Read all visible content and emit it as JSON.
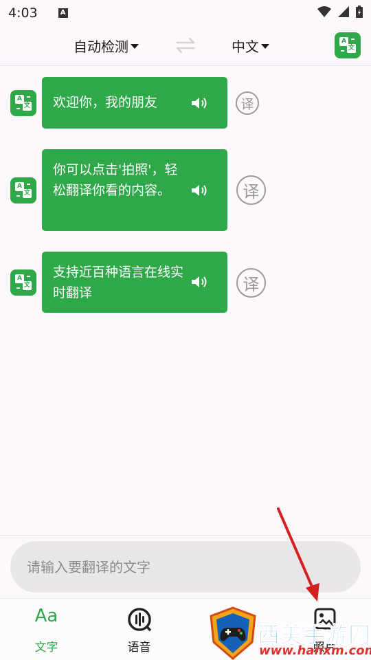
{
  "status_bar": {
    "time": "4:03",
    "a_icon": "A"
  },
  "header": {
    "source_language": "自动检测",
    "target_language": "中文"
  },
  "messages": [
    {
      "text": "欢迎你，我的朋友",
      "translate_label": "译"
    },
    {
      "text": "你可以点击'拍照'，轻松翻译你看的内容。",
      "translate_label": "译"
    },
    {
      "text": "支持近百种语言在线实时翻译",
      "translate_label": "译"
    }
  ],
  "input": {
    "placeholder": "请输入要翻译的文字"
  },
  "nav": [
    {
      "label": "文字",
      "icon": "Aa"
    },
    {
      "label": "语音",
      "icon": "voice-icon"
    },
    {
      "label": "",
      "icon": "camera-icon"
    },
    {
      "label": "照片",
      "icon": "photo-icon"
    }
  ],
  "watermark": {
    "title": "西美手游网",
    "url": "www.hanxm.com"
  },
  "colors": {
    "accent": "#2fa84a",
    "background": "#fcf8fc"
  }
}
